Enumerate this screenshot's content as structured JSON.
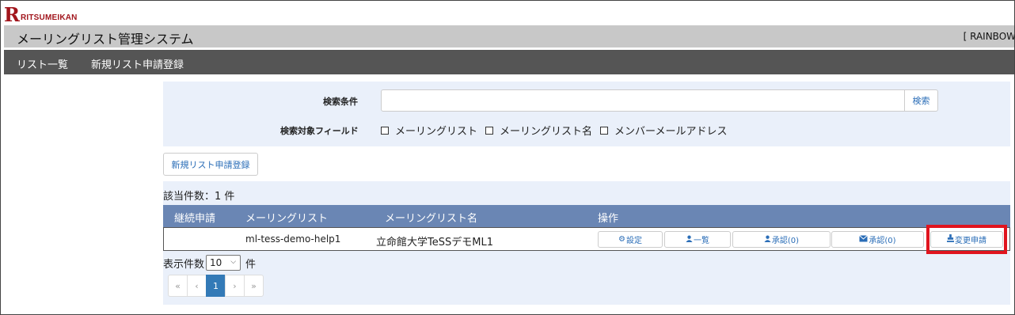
{
  "brand": {
    "mark": "R",
    "name": "RITSUMEIKAN",
    "color": "#a1151c"
  },
  "header": {
    "title": "メーリングリスト管理システム",
    "user": "[ RAINBOW"
  },
  "nav": {
    "items": [
      "リスト一覧",
      "新規リスト申請登録"
    ]
  },
  "search": {
    "label": "検索条件",
    "value": "",
    "button": "検索",
    "fields_label": "検索対象フィールド",
    "fields": [
      {
        "label": "メーリングリスト",
        "checked": false
      },
      {
        "label": "メーリングリスト名",
        "checked": false
      },
      {
        "label": "メンバーメールアドレス",
        "checked": false
      }
    ]
  },
  "new_request_button": "新規リスト申請登録",
  "results": {
    "count_text": "該当件数：1 件",
    "columns": [
      "継続申請",
      "メーリングリスト",
      "メーリングリスト名",
      "操作"
    ],
    "rows": [
      {
        "renewal": "",
        "list": "ml-tess-demo-help1",
        "name": "立命館大学TeSSデモML1",
        "actions": [
          {
            "label": "設定",
            "icon": "gear-icon"
          },
          {
            "label": "一覧",
            "icon": "user-icon"
          },
          {
            "label": "承認(0)",
            "icon": "user-icon"
          },
          {
            "label": "承認(0)",
            "icon": "envelope-icon"
          },
          {
            "label": "変更申請",
            "icon": "stamp-icon"
          }
        ]
      }
    ]
  },
  "paging": {
    "per_page_label": "表示件数",
    "per_page_value": "10",
    "per_page_unit": "件",
    "pages": [
      "«",
      "‹",
      "1",
      "›",
      "»"
    ],
    "current": "1"
  },
  "colors": {
    "table_header": "#6a86b4",
    "panel_bg": "#eaf0fa",
    "link": "#2a6db7",
    "highlight": "#e0141e",
    "active_page": "#337ab7"
  }
}
